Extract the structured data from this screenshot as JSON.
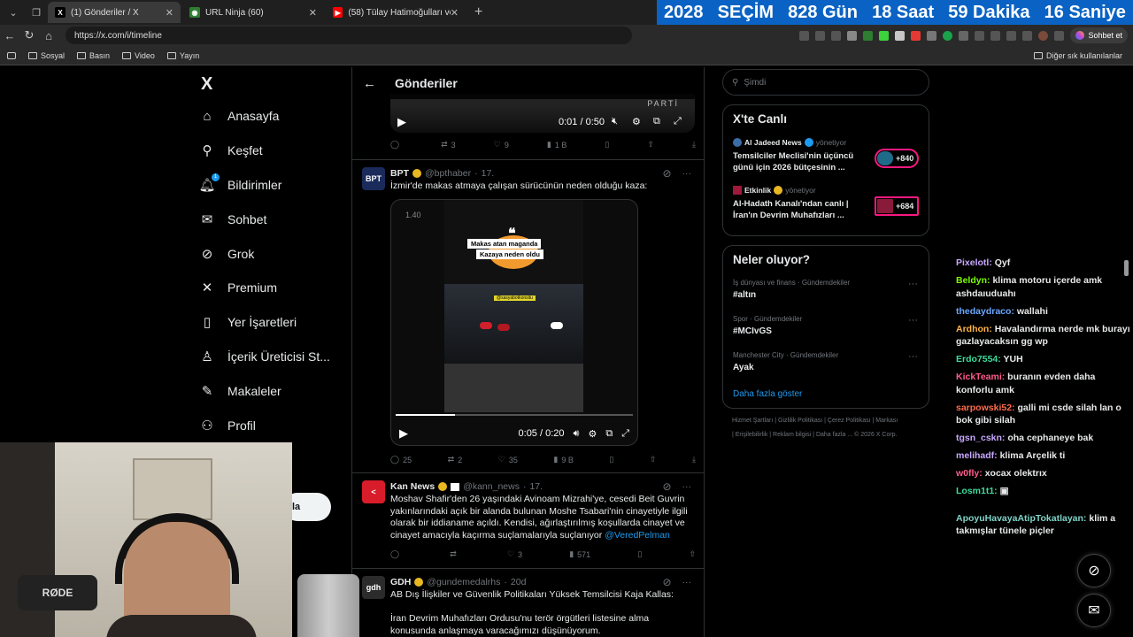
{
  "browser": {
    "tabs": [
      {
        "title": "(1) Gönderiler / X",
        "active": true
      },
      {
        "title": "URL Ninja (60)",
        "active": false
      },
      {
        "title": "(58) Tülay Hatimoğulları ve Tuncer...",
        "active": false
      }
    ],
    "url": "https://x.com/i/timeline",
    "bookmarks": [
      "Sosyal",
      "Basın",
      "Video",
      "Yayın"
    ],
    "other_bookmarks": "Diğer sık kullanılanlar",
    "chat_button": "Sohbet et"
  },
  "election": {
    "year": "2028",
    "label": "SEÇİM",
    "days": "828 Gün",
    "hours": "18 Saat",
    "minutes": "59 Dakika",
    "seconds": "16 Saniye"
  },
  "nav": {
    "logo": "X",
    "items": [
      {
        "label": "Anasayfa",
        "icon": "home-icon"
      },
      {
        "label": "Keşfet",
        "icon": "search-icon"
      },
      {
        "label": "Bildirimler",
        "icon": "bell-icon",
        "badge": "1"
      },
      {
        "label": "Sohbet",
        "icon": "mail-icon"
      },
      {
        "label": "Grok",
        "icon": "grok-icon"
      },
      {
        "label": "Premium",
        "icon": "x-icon"
      },
      {
        "label": "Yer İşaretleri",
        "icon": "bookmark-icon"
      },
      {
        "label": "İçerik Üreticisi St...",
        "icon": "creator-icon"
      },
      {
        "label": "Makaleler",
        "icon": "article-icon"
      },
      {
        "label": "Profil",
        "icon": "profile-icon"
      }
    ],
    "post_button": "la"
  },
  "feed": {
    "title": "Gönderiler",
    "top_video": {
      "time": "0:01 / 0:50",
      "overlay_text": "PARTİ"
    },
    "top_actions": {
      "replies": "",
      "reposts": "3",
      "likes": "9",
      "views": "1 B"
    },
    "posts": [
      {
        "name": "BPT",
        "handle": "@bpthaber",
        "time": "17.",
        "avatar": "BPT",
        "text": "İzmir'de makas atmaya çalışan sürücünün neden olduğu kaza:",
        "video": {
          "counter": "1.40",
          "caption1": "Makas atan maganda",
          "caption2": "Kazaya neden oldu",
          "handle_tag": "@sasyabotkonsitu",
          "time": "0:05 / 0:20",
          "progress": 0.25
        },
        "actions": {
          "replies": "25",
          "reposts": "2",
          "likes": "35",
          "views": "9 B"
        }
      },
      {
        "name": "Kan News",
        "handle": "@kann_news",
        "time": "17.",
        "avatar": "<",
        "text": "Moshav Shafir'den 26 yaşındaki Avinoam Mizrahi'ye, cesedi Beit Guvrin yakınlarındaki açık bir alanda bulunan Moshe Tsabari'nin cinayetiyle ilgili olarak bir iddianame açıldı. Kendisi, ağırlaştırılmış koşullarda cinayet ve cinayet amacıyla kaçırma suçlamalarıyla suçlanıyor",
        "mention": "@VeredPelman",
        "actions": {
          "replies": "",
          "reposts": "",
          "likes": "3",
          "views": "571"
        }
      },
      {
        "name": "GDH",
        "handle": "@gundemedalrhs",
        "time": "20d",
        "avatar": "gdh",
        "text1": "AB Dış İlişkiler ve Güvenlik Politikaları Yüksek Temsilcisi Kaja Kallas:",
        "text2": "İran Devrim Muhafızları Ordusu'nu terör örgütleri listesine alma konusunda anlaşmaya varacağımızı düşünüyorum."
      }
    ]
  },
  "right": {
    "search_placeholder": "Şimdi",
    "live_title": "X'te Canlı",
    "live": [
      {
        "source": "Al Jadeed News",
        "role": "yönetiyor",
        "text": "Temsilciler Meclisi'nin üçüncü günü için 2026 bütçesinin ...",
        "count": "+840"
      },
      {
        "source": "Etkinlik",
        "role": "yönetiyor",
        "text": "Al-Hadath Kanalı'ndan canlı | İran'ın Devrim Muhafızları ...",
        "count": "+684"
      }
    ],
    "trends_title": "Neler oluyor?",
    "trends": [
      {
        "category": "İş dünyası ve finans · Gündemdekiler",
        "name": "#altın"
      },
      {
        "category": "Spor · Gündemdekiler",
        "name": "#MCIvGS"
      },
      {
        "category": "Manchester City · Gündemdekiler",
        "name": "Ayak"
      }
    ],
    "show_more": "Daha fazla göster",
    "footer": [
      "Hizmet Şartları",
      "Gizlilik Politikası",
      "Çerez Politikası",
      "Markası",
      "Erişilebilirlik",
      "Reklam bilgisi",
      "Daha fazla ...",
      "© 2026 X Corp."
    ]
  },
  "chat": [
    {
      "user": "Pixelotl:",
      "color": "#c8a8ff",
      "msg": "Qyf"
    },
    {
      "user": "Beldyn:",
      "color": "#7cfc00",
      "msg": "klima motoru içerde amk ashdaıuduahı"
    },
    {
      "user": "thedaydraco:",
      "color": "#6aa8ff",
      "msg": "wallahi"
    },
    {
      "user": "Ardhon:",
      "color": "#ffb347",
      "msg": "Havalandırma nerde mk burayı gazlayacaksın gg wp"
    },
    {
      "user": "Erdo7554:",
      "color": "#3cdc9c",
      "msg": "YUH"
    },
    {
      "user": "KickTeami:",
      "color": "#ff5c8a",
      "msg": "buranın evden daha konforlu amk"
    },
    {
      "user": "sarpowski52:",
      "color": "#ff6b4a",
      "msg": "galli mi csde silah lan o bok gibi silah"
    },
    {
      "user": "tgsn_cskn:",
      "color": "#c8a8ff",
      "msg": "oha cephaneye bak"
    },
    {
      "user": "melihadf:",
      "color": "#c8a8ff",
      "msg": "klima Arçelik ti"
    },
    {
      "user": "w0fly:",
      "color": "#ff5c8a",
      "msg": "xocax olektrıx"
    },
    {
      "user": "Losm1t1:",
      "color": "#3cdc9c",
      "msg": "▣"
    },
    {
      "user": "ApoyuHavayaAtipTokatlayan:",
      "color": "#7fd3c8",
      "msg": "klim a takmışlar tünele piçler"
    }
  ],
  "colors": {
    "accent": "#1d9bf0",
    "election_bg": "#0a63c4",
    "live_pill": "#f91880"
  }
}
